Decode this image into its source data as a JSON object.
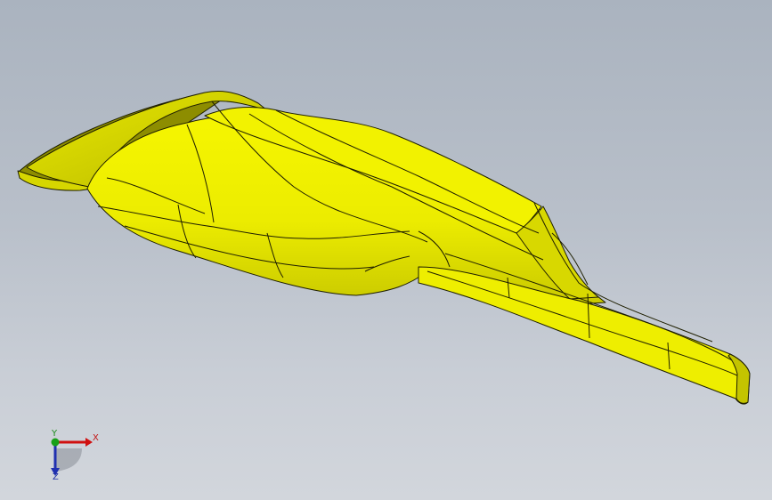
{
  "scene": {
    "model_color": "#ecec00",
    "model_shade_color": "#b8b800",
    "edge_color": "#1f1f00"
  },
  "triad": {
    "x_label": "X",
    "y_label": "Y",
    "z_label": "Z",
    "x_color": "#d01010",
    "y_color": "#18a018",
    "z_color": "#2030b0"
  }
}
